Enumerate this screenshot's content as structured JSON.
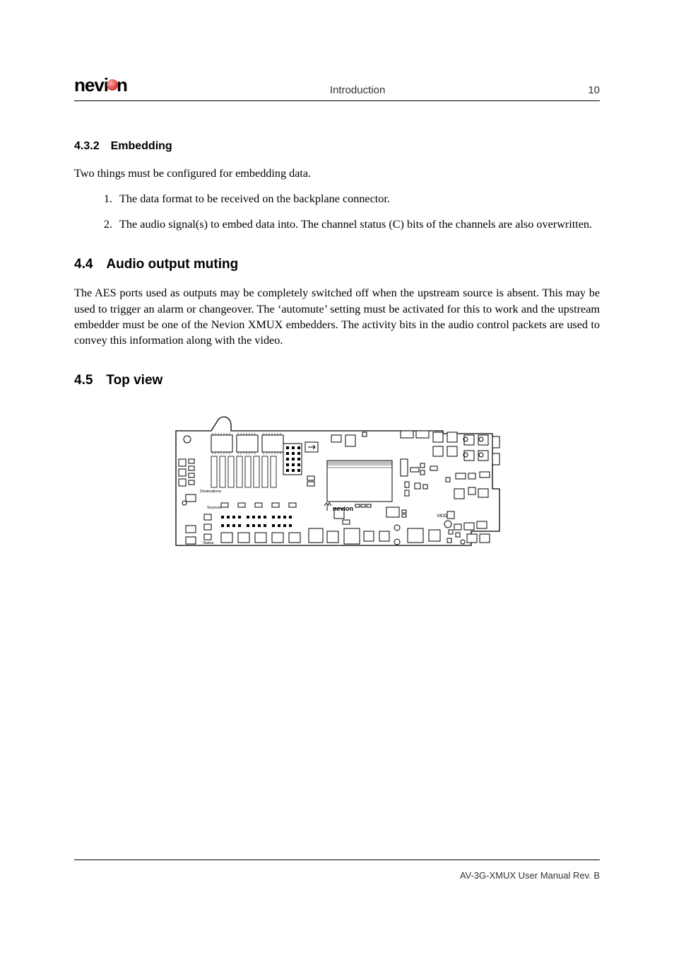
{
  "header": {
    "logo_text_left": "nevi",
    "logo_text_right": "n",
    "section_name": "Introduction",
    "page_number": "10"
  },
  "section_4_3_2": {
    "number_title": "4.3.2 Embedding",
    "intro": "Two things must be configured for embedding data.",
    "items": [
      "The data format to be received on the backplane connector.",
      "The audio signal(s) to embed data into. The channel status (C) bits of the channels are also overwritten."
    ]
  },
  "section_4_4": {
    "number_title": "4.4 Audio output muting",
    "body": "The AES ports used as outputs may be completely switched off when the upstream source is absent. This may be used to trigger an alarm or changeover. The ‘automute’ setting must be activated for this to work and the upstream embedder must be one of the Nevion XMUX embedders. The activity bits in the audio control packets are used to convey this information along with the video."
  },
  "section_4_5": {
    "number_title": "4.5 Top view",
    "figure_brand": "nevion",
    "figure_label_mod": "MOD",
    "figure_label_dest": "Destinations",
    "figure_label_src": "Sources",
    "figure_label_status": "Status"
  },
  "footer": {
    "text": "AV-3G-XMUX User Manual Rev. B"
  }
}
